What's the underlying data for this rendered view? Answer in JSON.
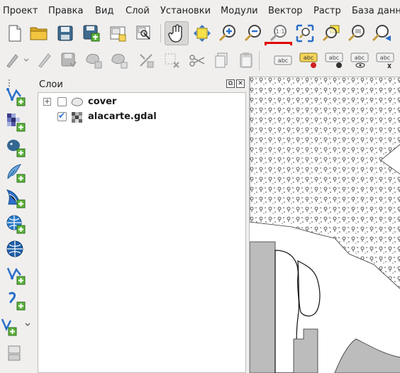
{
  "menubar": {
    "items": [
      {
        "label": "Проект",
        "mnemonic": "П",
        "rest": "роект"
      },
      {
        "label": "Правка",
        "mnemonic": "р",
        "first": "П",
        "rest": "авка"
      },
      {
        "label": "Вид",
        "mnemonic": "В",
        "rest": "ид"
      },
      {
        "label": "Слой",
        "mnemonic": "С",
        "rest": "лой"
      },
      {
        "label": "Установки",
        "mnemonic": "У",
        "rest": "становки"
      },
      {
        "label": "Модули",
        "mnemonic": "М",
        "rest": "одули"
      },
      {
        "label": "Вектор",
        "mnemonic": "В",
        "rest": "ектор"
      },
      {
        "label": "Растр",
        "mnemonic": "Р",
        "rest": "астр"
      },
      {
        "label": "База данных",
        "mnemonic": "Б",
        "rest": "аза данных"
      }
    ]
  },
  "toolbar1": {
    "buttons": [
      "new-project-icon",
      "open-project-icon",
      "save-project-icon",
      "save-as-icon",
      "new-print-layout-icon",
      "layout-manager-icon",
      "pan-map-icon",
      "pan-to-selection-icon",
      "zoom-in-icon",
      "zoom-out-icon",
      "zoom-native-resolution-icon",
      "zoom-full-icon",
      "zoom-to-selection-icon",
      "zoom-to-layer-icon",
      "zoom-last-icon"
    ],
    "highlighted": "zoom-native-resolution-icon",
    "zoom_native_label": "1:1"
  },
  "toolbar2": {
    "buttons": [
      "digitize-icon",
      "edit-pencil-icon",
      "save-edits-icon",
      "add-feature-icon",
      "add-polygon-icon",
      "vertex-tool-icon",
      "delete-selected-icon",
      "cut-features-icon",
      "copy-features-icon",
      "paste-features-icon",
      "label-tool-icon",
      "pin-labels-icon",
      "highlight-labels-icon",
      "show-hide-labels-icon",
      "move-label-icon"
    ],
    "label_text": "abc"
  },
  "leftbar": {
    "buttons": [
      "add-vector-layer-icon",
      "add-raster-layer-icon",
      "add-postgis-layer-icon",
      "add-spatialite-layer-icon",
      "add-mssql-layer-icon",
      "add-wms-layer-icon",
      "add-wcs-layer-icon",
      "add-wfs-layer-icon",
      "add-delimited-text-icon",
      "new-shapefile-icon",
      "add-virtual-layer-icon"
    ]
  },
  "layers_panel": {
    "title": "Слои",
    "float_button": "⧉",
    "close_button": "✕",
    "layers": [
      {
        "name": "cover",
        "checked": false,
        "expandable": true,
        "expander": "+",
        "icon": "polygon-layer-icon"
      },
      {
        "name": "alacarte.gdal",
        "checked": true,
        "expandable": false,
        "icon": "raster-layer-icon"
      }
    ]
  },
  "colors": {
    "background": "#f0efee",
    "highlight": "#e00000",
    "checkbox_accent": "#2a6fc9",
    "map_fill_gray": "#bcbcbc"
  }
}
